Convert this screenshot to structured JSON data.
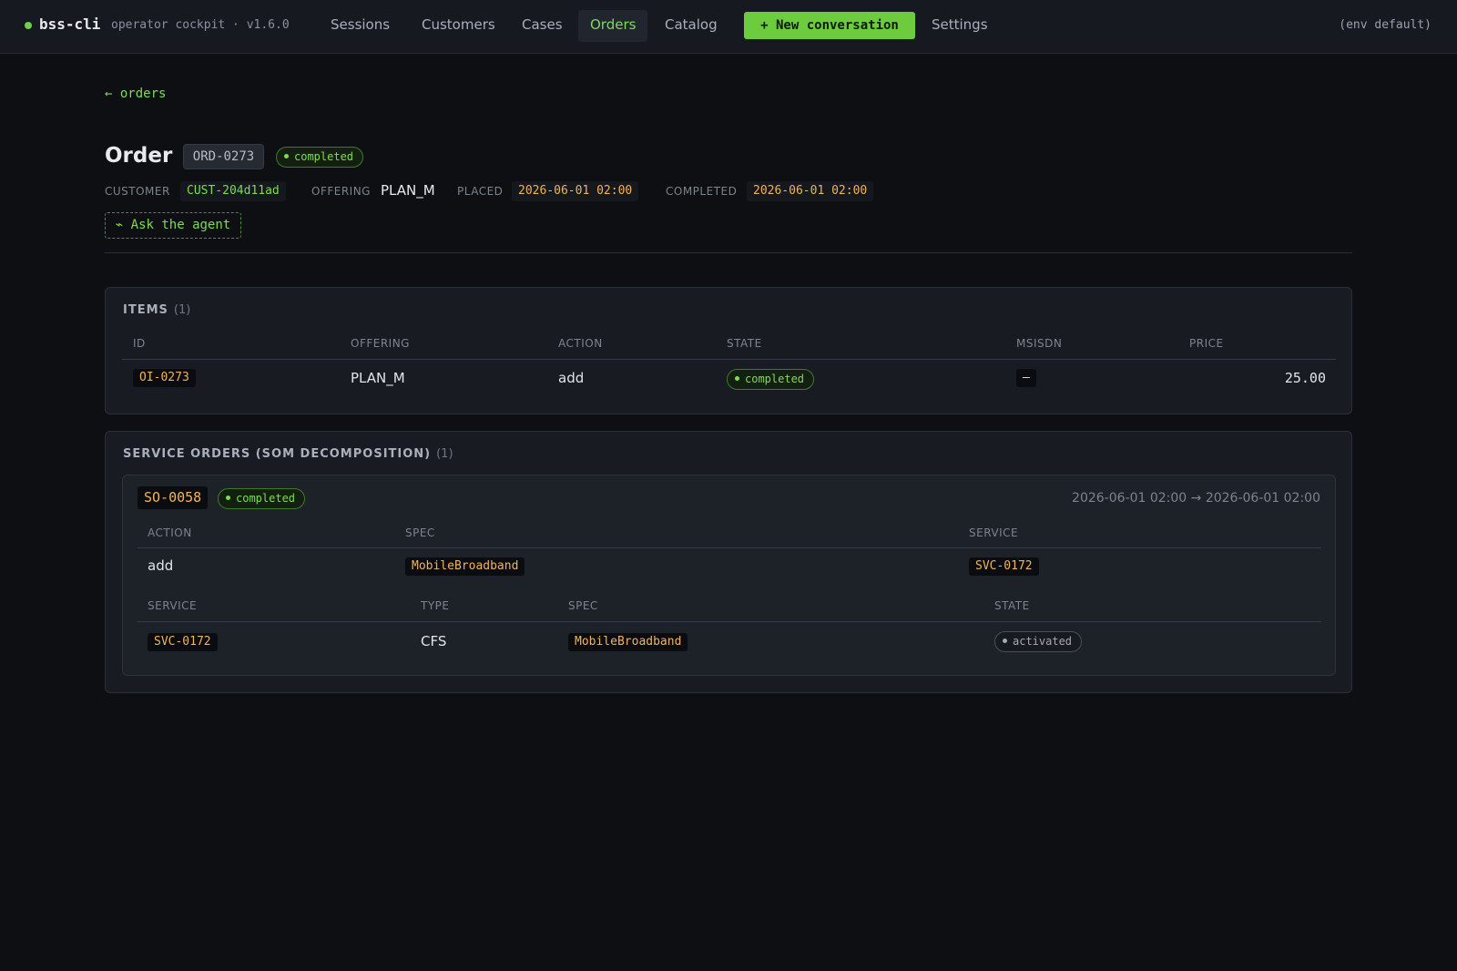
{
  "nav": {
    "brand": "bss-cli",
    "subtitle": "operator cockpit · v1.6.0",
    "items": [
      "Sessions",
      "Customers",
      "Cases",
      "Orders",
      "Catalog"
    ],
    "new_button": "+ New conversation",
    "settings": "Settings",
    "env": "(env default)"
  },
  "header": {
    "back": "← orders",
    "title": "Order",
    "order_id": "ORD-0273",
    "status": "completed",
    "customer_label": "CUSTOMER",
    "customer": "CUST-204d11ad",
    "offering_label": "OFFERING",
    "offering": "PLAN_M",
    "placed_label": "PLACED",
    "placed": "2026-06-01 02:00",
    "completed_label": "COMPLETED",
    "completed": "2026-06-01 02:00",
    "ask_agent": "⌁ Ask the agent"
  },
  "items": {
    "title": "ITEMS",
    "count": "(1)",
    "columns": [
      "ID",
      "OFFERING",
      "ACTION",
      "STATE",
      "MSISDN",
      "PRICE"
    ],
    "rows": [
      {
        "id": "OI-0273",
        "offering": "PLAN_M",
        "action": "add",
        "state": "completed",
        "msisdn": "—",
        "price": "25.00"
      }
    ]
  },
  "service_orders": {
    "title": "SERVICE ORDERS (SOM DECOMPOSITION)",
    "count": "(1)",
    "orders": [
      {
        "id": "SO-0058",
        "status": "completed",
        "time": "2026-06-01 02:00 → 2026-06-01 02:00",
        "columns": [
          "ACTION",
          "SPEC",
          "SERVICE"
        ],
        "row": {
          "action": "add",
          "spec": "MobileBroadband",
          "service": "SVC-0172"
        },
        "services_columns": [
          "SERVICE",
          "TYPE",
          "SPEC",
          "STATE"
        ],
        "services": [
          {
            "service": "SVC-0172",
            "type": "CFS",
            "spec": "MobileBroadband",
            "state": "activated"
          }
        ]
      }
    ]
  },
  "colors": {
    "accent": "#6fd14a",
    "background": "#0d0f13",
    "code": "#f0b45a"
  }
}
